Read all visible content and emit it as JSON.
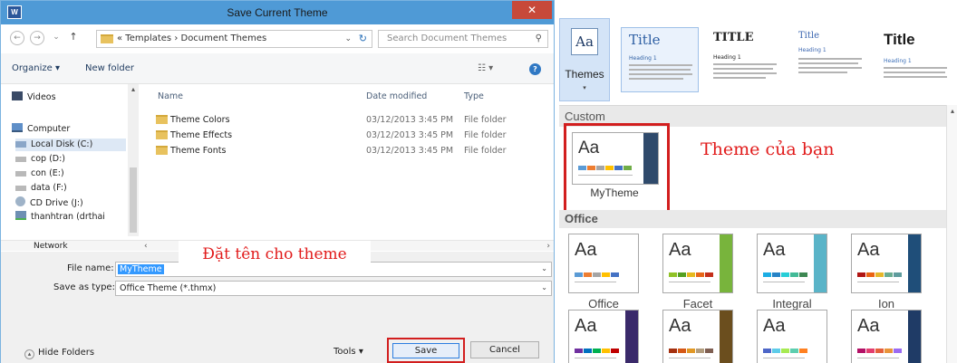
{
  "dialog": {
    "title": "Save Current Theme",
    "close_glyph": "✕",
    "app_icon_letter": "W",
    "nav": {
      "back": "←",
      "forward": "→",
      "recent": "⌄",
      "up": "↑"
    },
    "breadcrumb": "« Templates  ›  Document Themes",
    "address_dropdown": "⌄",
    "refresh_glyph": "↻",
    "search_placeholder": "Search Document Themes",
    "search_glyph": "⚲",
    "toolbar": {
      "organize": "Organize ▾",
      "new_folder": "New folder",
      "views": "☷ ▾",
      "help": "?"
    },
    "sidebar": [
      {
        "label": "Videos",
        "icon": "video-icon"
      },
      {
        "label": "Computer",
        "icon": "computer-icon"
      },
      {
        "label": "Local Disk (C:)",
        "icon": "drive-icon"
      },
      {
        "label": "cop (D:)",
        "icon": "drive-icon"
      },
      {
        "label": "con (E:)",
        "icon": "drive-icon"
      },
      {
        "label": "data (F:)",
        "icon": "drive-icon"
      },
      {
        "label": "CD Drive (J:)",
        "icon": "cd-drive-icon"
      },
      {
        "label": "thanhtran (drthai",
        "icon": "network-drive-icon"
      },
      {
        "label": "Network",
        "icon": "network-icon"
      }
    ],
    "columns": {
      "name": "Name",
      "date": "Date modified",
      "type": "Type"
    },
    "files": [
      {
        "name": "Theme Colors",
        "date": "03/12/2013 3:45 PM",
        "type": "File folder"
      },
      {
        "name": "Theme Effects",
        "date": "03/12/2013 3:45 PM",
        "type": "File folder"
      },
      {
        "name": "Theme Fonts",
        "date": "03/12/2013 3:45 PM",
        "type": "File folder"
      }
    ],
    "file_name_label": "File name:",
    "file_name_value": "MyTheme",
    "save_type_label": "Save as type:",
    "save_type_value": "Office Theme (*.thmx)",
    "hide_folders": "Hide Folders",
    "tools": "Tools  ▾",
    "save": "Save",
    "cancel": "Cancel",
    "annotation": "Đặt tên cho theme"
  },
  "gallery": {
    "themes_button": "Themes",
    "themes_aa": "Aa",
    "themes_arrow": "▾",
    "style_cards": [
      {
        "title": "Title",
        "heading": "Heading 1",
        "title_color": "#2e5fa3",
        "heading_color": "#2e5fa3",
        "title_font": "DejaVu Serif"
      },
      {
        "title": "TITLE",
        "heading": "Heading 1",
        "title_color": "#222222",
        "heading_color": "#222222",
        "title_font": "DejaVu Serif"
      },
      {
        "title": "Title",
        "heading": "Heading 1",
        "title_color": "#3b66b0",
        "heading_color": "#3b66b0",
        "title_font": "DejaVu Serif"
      },
      {
        "title": "Title",
        "heading": "Heading 1",
        "title_color": "#1a1a1a",
        "heading_color": "#3b6fb8",
        "title_font": "Liberation Sans"
      }
    ],
    "custom_header": "Custom",
    "office_header": "Office",
    "my_theme": {
      "name": "MyTheme",
      "aa": "Aa"
    },
    "annotation": "Theme của bạn",
    "themes": [
      {
        "name": "Office",
        "aa": "Aa",
        "side": "#ffffff",
        "colors": [
          "#5b9bd5",
          "#ed7d31",
          "#a5a5a5",
          "#ffc000",
          "#4472c4"
        ]
      },
      {
        "name": "Facet",
        "aa": "Aa",
        "side": "#78b43c",
        "colors": [
          "#90c226",
          "#54a021",
          "#e6b91e",
          "#e76618",
          "#c42f1a"
        ]
      },
      {
        "name": "Integral",
        "aa": "Aa",
        "side": "#5ab4c8",
        "colors": [
          "#1cade4",
          "#2683c6",
          "#27ced7",
          "#42ba97",
          "#3e8853"
        ]
      },
      {
        "name": "Ion",
        "aa": "Aa",
        "side": "#1f4e79",
        "colors": [
          "#b01513",
          "#ea6312",
          "#e6b729",
          "#6aac90",
          "#5f9c9d"
        ]
      },
      {
        "name": "",
        "aa": "Aa",
        "side": "#3a2a6a",
        "colors": [
          "#7030a0",
          "#0070c0",
          "#00b050",
          "#ffc000",
          "#c00000"
        ]
      },
      {
        "name": "",
        "aa": "Aa",
        "side": "#6b4e1e",
        "colors": [
          "#a5300f",
          "#d55816",
          "#e19825",
          "#b19c7d",
          "#7f5f52"
        ]
      },
      {
        "name": "",
        "aa": "Aa",
        "side": "#ffffff",
        "colors": [
          "#4e67c8",
          "#5ecce9",
          "#a7ea52",
          "#5dceaf",
          "#ff8021"
        ]
      },
      {
        "name": "",
        "aa": "Aa",
        "side": "#1f3b66",
        "colors": [
          "#b31166",
          "#e33d6f",
          "#e45f3c",
          "#e9943a",
          "#9b6bf2"
        ]
      }
    ],
    "scroll_up": "▴"
  },
  "colors": {
    "titlebar": "#4f9ad6",
    "close": "#c7493a",
    "highlight_red": "#d21e1e",
    "annotation_red": "#e11b1b",
    "selection_blue": "#3399ff",
    "folder_yellow": "#e8c25e",
    "mytheme_colors": [
      "#5b9bd5",
      "#ed7d31",
      "#a5a5a5",
      "#ffc000",
      "#4472c4",
      "#70ad47"
    ]
  }
}
